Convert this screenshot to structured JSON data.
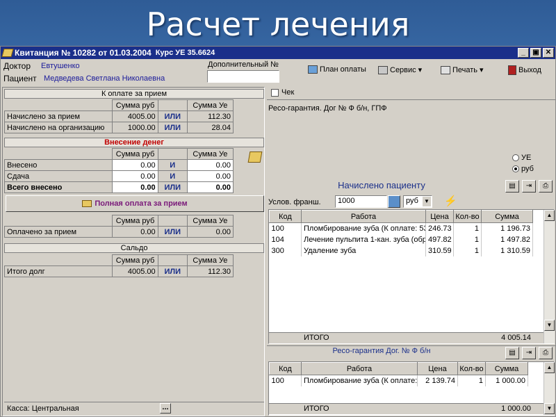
{
  "slide": {
    "title": "Расчет лечения"
  },
  "window": {
    "title": "Квитанция № 10282 от 01.03.2004",
    "rate": "Курс УЕ 35.6624",
    "controls": {
      "minimize": "_",
      "restore": "▣",
      "close": "✕"
    }
  },
  "header": {
    "doctor_label": "Доктор",
    "doctor_name": "Евтушенко",
    "patient_label": "Пациент",
    "patient_name": "Медведева Светлана Николаевна",
    "extra_number_label": "Дополнительный №",
    "extra_number_value": "",
    "toolbar": {
      "plan": "План оплаты",
      "service": "Сервис",
      "print": "Печать",
      "exit": "Выход"
    }
  },
  "left": {
    "payable": {
      "title": "К оплате за прием",
      "col_rub": "Сумма руб",
      "col_ue": "Сумма Уе",
      "rows": [
        {
          "label": "Начислено за прием",
          "rub": "4005.00",
          "op": "ИЛИ",
          "ue": "112.30"
        },
        {
          "label": "Начислено на организацию",
          "rub": "1000.00",
          "op": "ИЛИ",
          "ue": "28.04"
        }
      ]
    },
    "deposit": {
      "title": "Внесение денег",
      "col_rub": "Сумма руб",
      "col_ue": "Сумма Уе",
      "rows": [
        {
          "label": "Внесено",
          "rub": "0.00",
          "op": "И",
          "ue": "0.00"
        },
        {
          "label": "Сдача",
          "rub": "0.00",
          "op": "И",
          "ue": "0.00"
        },
        {
          "label": "Всего внесено",
          "rub": "0.00",
          "op": "ИЛИ",
          "ue": "0.00"
        }
      ]
    },
    "full_payment_button": "Полная оплата за прием",
    "paid": {
      "col_rub": "Сумма руб",
      "col_ue": "Сумма Уе",
      "row": {
        "label": "Оплачено за прием",
        "rub": "0.00",
        "op": "ИЛИ",
        "ue": "0.00"
      }
    },
    "balance": {
      "title": "Сальдо",
      "col_rub": "Сумма руб",
      "col_ue": "Сумма Уе",
      "row": {
        "label": "Итого долг",
        "rub": "4005.00",
        "op": "ИЛИ",
        "ue": "112.30"
      }
    },
    "status": {
      "cash_label": "Касса:",
      "cash_value": "Центральная",
      "dots": "..."
    }
  },
  "right": {
    "check_label": "Чек",
    "guarantee_text": "Ресо-гарантия. Дог № Ф б/н, ГПФ",
    "currency_options": [
      "УЕ",
      "руб"
    ],
    "currency_selected": "руб",
    "charged_title": "Начислено пациенту",
    "franchise_label": "Услов. франш.",
    "franchise_value": "1000",
    "franchise_currency": "руб",
    "columns": [
      "Код",
      "Работа",
      "Цена",
      "Кол-во",
      "Сумма"
    ],
    "rows": [
      {
        "code": "100",
        "work": "Пломбирование зуба (К оплате: 53",
        "price": "246.73",
        "qty": "1",
        "sum": "1 196.73"
      },
      {
        "code": "104",
        "work": "Лечение пульпита 1-кан. зуба (обр",
        "price": "497.82",
        "qty": "1",
        "sum": "1 497.82"
      },
      {
        "code": "300",
        "work": "Удаление зуба",
        "price": "310.59",
        "qty": "1",
        "sum": "1 310.59"
      }
    ],
    "total_label": "ИТОГО",
    "total_value": "4 005.14",
    "insurer_title": "Ресо-гарантия Дог. № Ф б/н",
    "insurer_rows": [
      {
        "code": "100",
        "work": "Пломбирование зуба (К оплате:",
        "price": "2 139.74",
        "qty": "1",
        "sum": "1 000.00"
      }
    ],
    "insurer_total_label": "ИТОГО",
    "insurer_total_value": "1 000.00"
  }
}
